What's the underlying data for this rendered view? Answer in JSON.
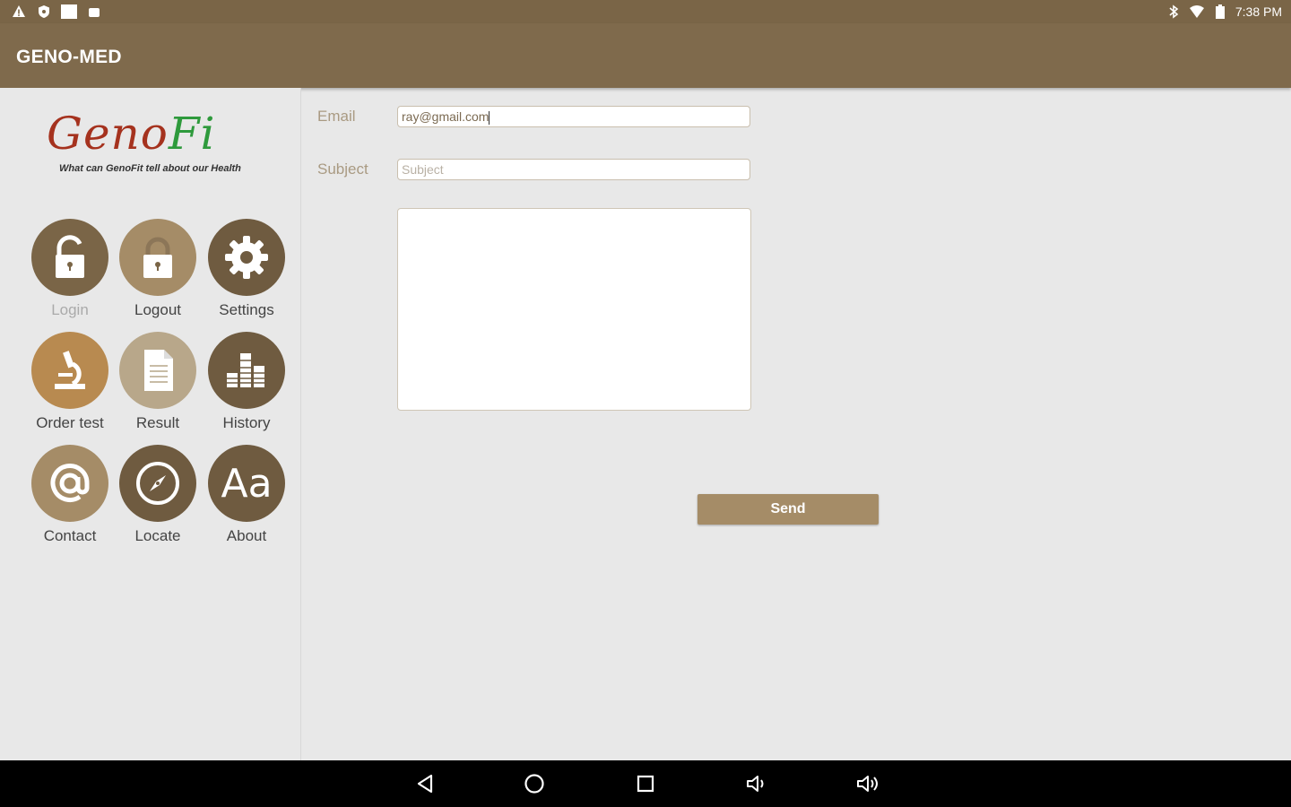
{
  "status_bar": {
    "left_icons": [
      "warning-icon",
      "shield-icon",
      "image-icon",
      "android-icon"
    ],
    "right_icons": [
      "bluetooth-icon",
      "wifi-icon",
      "battery-icon"
    ],
    "time": "7:38 PM"
  },
  "app_bar": {
    "title": "GENO-MED"
  },
  "logo": {
    "geno": "Geno",
    "fi": "Fi",
    "tagline": "What can GenoFit tell about our Health"
  },
  "menu": {
    "items": [
      {
        "label": "Login",
        "icon": "unlock-icon",
        "color": "#7a6547",
        "disabled": true
      },
      {
        "label": "Logout",
        "icon": "lock-icon",
        "color": "#a58c67",
        "disabled": false
      },
      {
        "label": "Settings",
        "icon": "gear-icon",
        "color": "#6f5b40",
        "disabled": false
      },
      {
        "label": "Order test",
        "icon": "microscope-icon",
        "color": "#b88a50",
        "disabled": false
      },
      {
        "label": "Result",
        "icon": "document-icon",
        "color": "#b8a78a",
        "disabled": false
      },
      {
        "label": "History",
        "icon": "bar-chart-icon",
        "color": "#6f5b40",
        "disabled": false
      },
      {
        "label": "Contact",
        "icon": "at-icon",
        "color": "#a58c67",
        "disabled": false
      },
      {
        "label": "Locate",
        "icon": "compass-icon",
        "color": "#6f5b40",
        "disabled": false
      },
      {
        "label": "About",
        "icon": "font-icon",
        "color": "#6f5b40",
        "disabled": false
      }
    ]
  },
  "form": {
    "email_label": "Email",
    "email_value": "ray@gmail.com",
    "subject_label": "Subject",
    "subject_placeholder": "Subject",
    "message_value": "",
    "send_label": "Send"
  },
  "nav_bar": {
    "buttons": [
      "back-icon",
      "home-icon",
      "recents-icon",
      "volume-down-icon",
      "volume-up-icon"
    ]
  },
  "colors": {
    "primary": "#7f6a4c",
    "accent": "#a58c67",
    "background": "#e8e8e8"
  }
}
